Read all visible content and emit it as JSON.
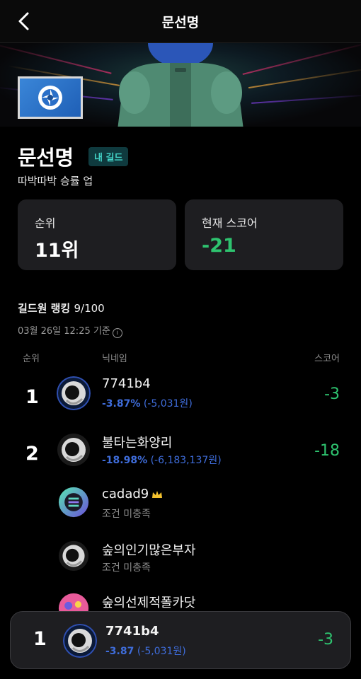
{
  "header": {
    "title": "문선명"
  },
  "guild": {
    "name": "문선명",
    "badge": "내 길드",
    "description": "따박따박 승률 업"
  },
  "stats": {
    "rank_label": "순위",
    "rank_value": "11위",
    "score_label": "현재 스코어",
    "score_value": "-21"
  },
  "ranking": {
    "title": "길드원 랭킹",
    "count": "9/100",
    "updated": "03월 26일 12:25 기준",
    "col_rank": "순위",
    "col_nick": "닉네임",
    "col_score": "스코어",
    "members": [
      {
        "rank": "1",
        "nick": "7741b4",
        "pct": "-3.87%",
        "amount": "(-5,031원)",
        "score": "-3"
      },
      {
        "rank": "2",
        "nick": "불타는화양리",
        "pct": "-18.98%",
        "amount": "(-6,183,137원)",
        "score": "-18"
      },
      {
        "rank": "",
        "nick": "cadad9",
        "status": "조건 미충족",
        "score": ""
      },
      {
        "rank": "",
        "nick": "숲의인기많은부자",
        "status": "조건 미충족",
        "score": ""
      },
      {
        "rank": "",
        "nick": "숲의선제적폴카닷",
        "status": "",
        "score": ""
      }
    ]
  },
  "my_entry": {
    "rank": "1",
    "nick": "7741b4",
    "pct": "-3.87",
    "amount": "(-5,031원)",
    "score": "-3"
  },
  "colors": {
    "positive": "#2ec36f",
    "change": "#3f6ddb",
    "badge_bg": "#0f3a3e",
    "badge_text": "#43d3c7"
  }
}
